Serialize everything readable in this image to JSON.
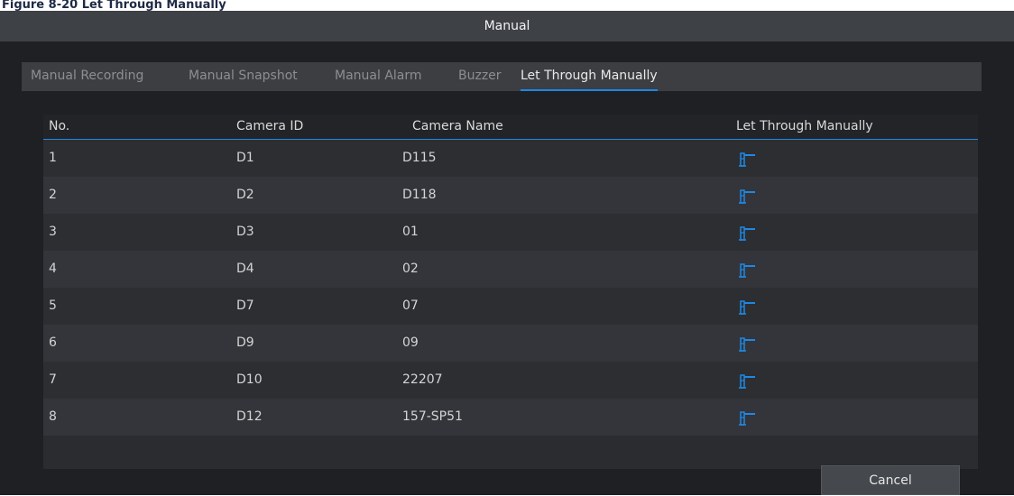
{
  "caption": "Figure 8-20 Let Through Manually",
  "dialog": {
    "title": "Manual",
    "tabs": [
      {
        "label": "Manual Recording",
        "active": false
      },
      {
        "label": "Manual Snapshot",
        "active": false
      },
      {
        "label": "Manual Alarm",
        "active": false
      },
      {
        "label": "Buzzer",
        "active": false
      },
      {
        "label": "Let Through Manually",
        "active": true
      }
    ],
    "table": {
      "headers": {
        "no": "No.",
        "camera_id": "Camera ID",
        "camera_name": "Camera Name",
        "action": "Let Through Manually"
      },
      "rows": [
        {
          "no": "1",
          "camera_id": "D1",
          "camera_name": "D115",
          "action_icon": "barrier-gate-icon"
        },
        {
          "no": "2",
          "camera_id": "D2",
          "camera_name": "D118",
          "action_icon": "barrier-gate-icon"
        },
        {
          "no": "3",
          "camera_id": "D3",
          "camera_name": "01",
          "action_icon": "barrier-gate-icon"
        },
        {
          "no": "4",
          "camera_id": "D4",
          "camera_name": "02",
          "action_icon": "barrier-gate-icon"
        },
        {
          "no": "5",
          "camera_id": "D7",
          "camera_name": "07",
          "action_icon": "barrier-gate-icon"
        },
        {
          "no": "6",
          "camera_id": "D9",
          "camera_name": "09",
          "action_icon": "barrier-gate-icon"
        },
        {
          "no": "7",
          "camera_id": "D10",
          "camera_name": "22207",
          "action_icon": "barrier-gate-icon"
        },
        {
          "no": "8",
          "camera_id": "D12",
          "camera_name": "157-SP51",
          "action_icon": "barrier-gate-icon"
        }
      ]
    },
    "buttons": {
      "cancel": "Cancel"
    }
  },
  "colors": {
    "accent": "#1e88e5",
    "background": "#1e2023",
    "title_bar": "#3e4146"
  }
}
